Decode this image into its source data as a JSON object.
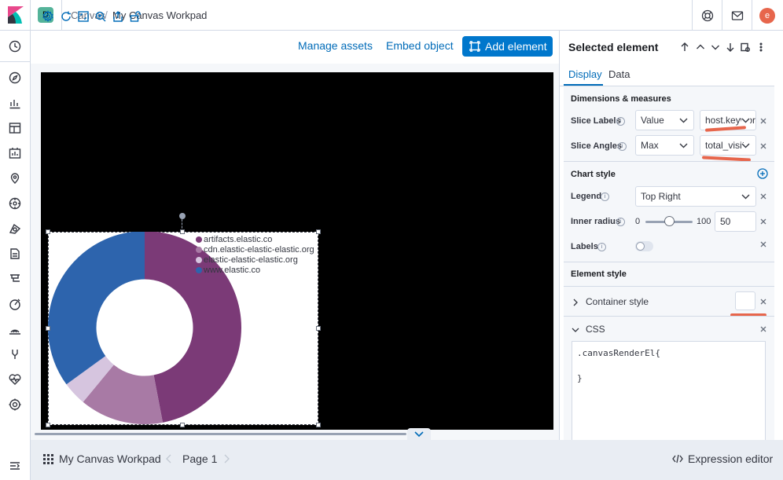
{
  "header": {
    "space_initial": "D",
    "breadcrumbs": [
      "Canvas",
      "My Canvas Workpad"
    ],
    "user_initial": "e"
  },
  "toolbar": {
    "manage_assets": "Manage assets",
    "embed_object": "Embed object",
    "add_element": "Add element"
  },
  "chart": {
    "legend": [
      "artifacts.elastic.co",
      "cdn.elastic-elastic-elastic.org",
      "elastic-elastic-elastic.org",
      "www.elastic.co"
    ],
    "colors": [
      "#7b3a77",
      "#a87aa5",
      "#d6c5df",
      "#2d64ad"
    ]
  },
  "chart_data": {
    "type": "pie",
    "categories": [
      "artifacts.elastic.co",
      "cdn.elastic-elastic-elastic.org",
      "elastic-elastic-elastic.org",
      "www.elastic.co"
    ],
    "values": [
      47,
      14,
      4,
      35
    ],
    "inner_radius": 50,
    "legend_position": "top-right"
  },
  "panel": {
    "title": "Selected element",
    "tabs": [
      "Display",
      "Data"
    ],
    "dimensions_title": "Dimensions & measures",
    "slice_labels": {
      "label": "Slice Labels",
      "fn": "Value",
      "field": "host.keyword"
    },
    "slice_angles": {
      "label": "Slice Angles",
      "fn": "Max",
      "field": "total_visits"
    },
    "chart_style_title": "Chart style",
    "legend": {
      "label": "Legend",
      "value": "Top Right"
    },
    "inner_radius": {
      "label": "Inner radius",
      "min": "0",
      "max": "100",
      "value": "50"
    },
    "labels": {
      "label": "Labels"
    },
    "element_style_title": "Element style",
    "container_style": "Container style",
    "css_label": "CSS",
    "css_line1": ".canvasRenderEl{",
    "css_line2": "}"
  },
  "footer": {
    "workpad_name": "My Canvas Workpad",
    "page": "Page 1",
    "expression_editor": "Expression editor"
  }
}
